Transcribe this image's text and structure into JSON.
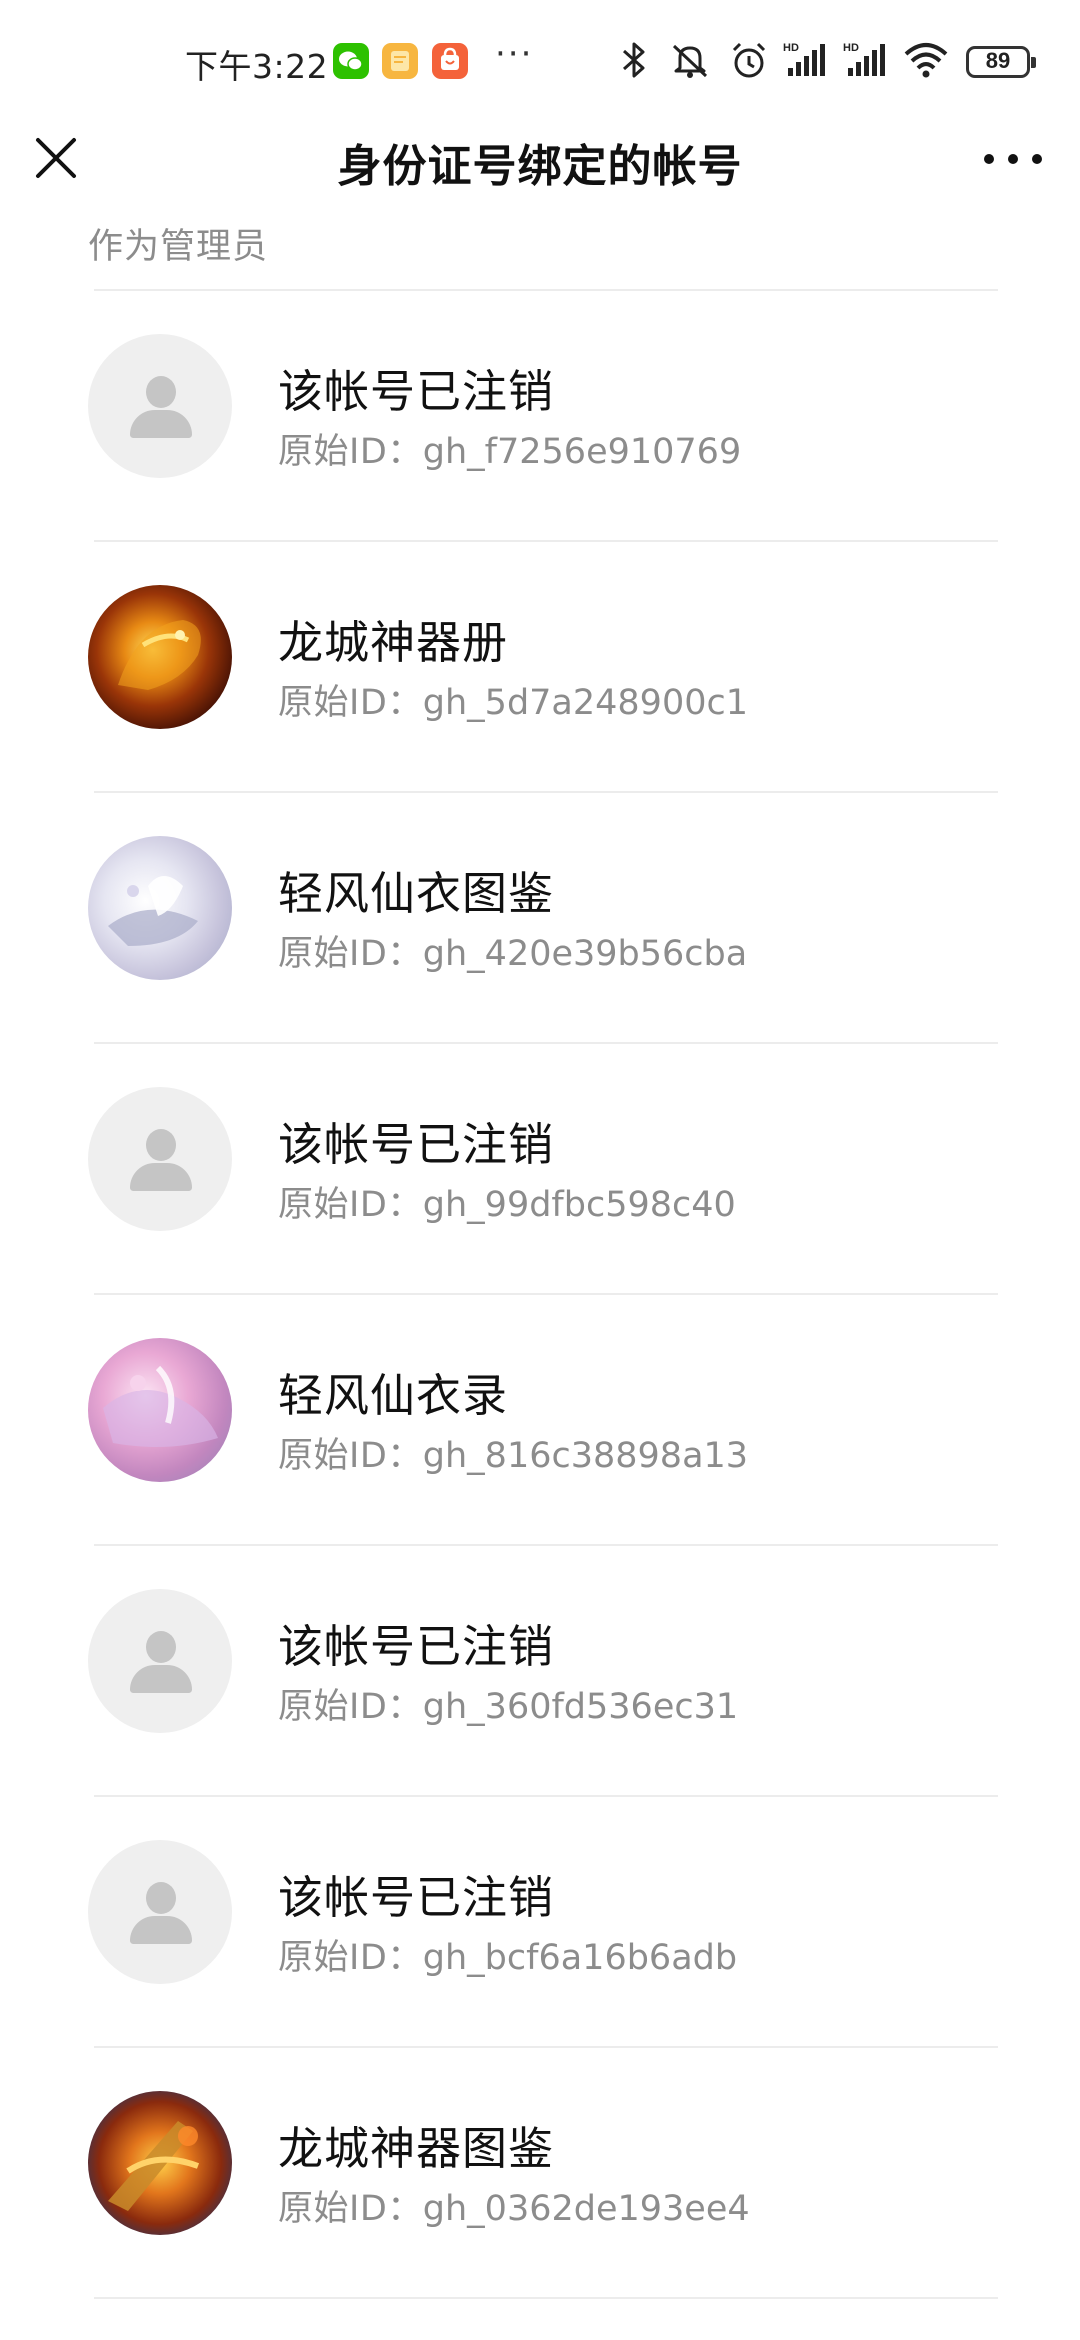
{
  "status_bar": {
    "time": "下午3:22",
    "app_icons": [
      "wechat-icon",
      "notes-icon",
      "shop-icon"
    ],
    "more": "···",
    "system_icons": [
      "bluetooth-icon",
      "mute-icon",
      "alarm-icon",
      "signal-hd-icon",
      "signal-hd-icon",
      "wifi-icon"
    ],
    "battery": "89"
  },
  "nav": {
    "title": "身份证号绑定的帐号"
  },
  "section": {
    "label": "作为管理员"
  },
  "accounts": [
    {
      "name": "该帐号已注销",
      "id_prefix": "原始ID：",
      "id": "gh_f7256e910769",
      "avatar": "placeholder"
    },
    {
      "name": "龙城神器册",
      "id_prefix": "原始ID：",
      "id": "gh_5d7a248900c1",
      "avatar": "dragon1"
    },
    {
      "name": "轻风仙衣图鉴",
      "id_prefix": "原始ID：",
      "id": "gh_420e39b56cba",
      "avatar": "fairy1"
    },
    {
      "name": "该帐号已注销",
      "id_prefix": "原始ID：",
      "id": "gh_99dfbc598c40",
      "avatar": "placeholder"
    },
    {
      "name": "轻风仙衣录",
      "id_prefix": "原始ID：",
      "id": "gh_816c38898a13",
      "avatar": "fairy2"
    },
    {
      "name": "该帐号已注销",
      "id_prefix": "原始ID：",
      "id": "gh_360fd536ec31",
      "avatar": "placeholder"
    },
    {
      "name": "该帐号已注销",
      "id_prefix": "原始ID：",
      "id": "gh_bcf6a16b6adb",
      "avatar": "placeholder"
    },
    {
      "name": "龙城神器图鉴",
      "id_prefix": "原始ID：",
      "id": "gh_0362de193ee4",
      "avatar": "dragon2"
    }
  ],
  "colors": {
    "background": "#ffffff",
    "primary_text": "#111111",
    "secondary_text": "#8c8c8c",
    "divider": "#ececec",
    "avatar_placeholder": "#efefef"
  }
}
